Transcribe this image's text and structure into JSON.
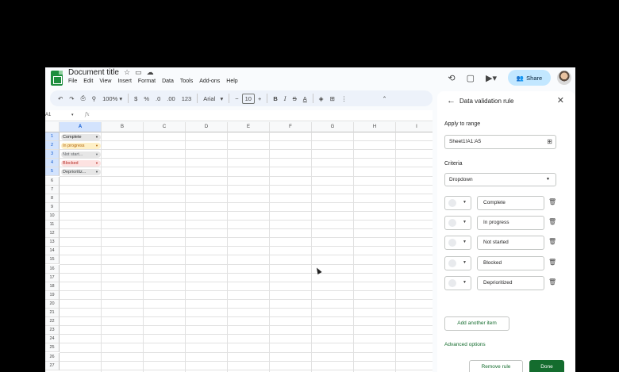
{
  "app": {
    "doc_title": "Document title",
    "menu": [
      "File",
      "Edit",
      "View",
      "Insert",
      "Format",
      "Data",
      "Tools",
      "Add-ons",
      "Help"
    ],
    "share_label": "Share"
  },
  "toolbar": {
    "zoom": "100%",
    "currency": "$",
    "percent": "%",
    "decimal_dec": ".0",
    "decimal_inc": ".00",
    "number_format": "123",
    "font": "Arial",
    "minus": "−",
    "font_size": "10",
    "plus": "+",
    "bold": "B",
    "italic": "I",
    "strike": "S",
    "text_color": "A"
  },
  "formula_bar": {
    "cell_ref": "A1",
    "fx": "fx"
  },
  "grid": {
    "columns": [
      "A",
      "B",
      "C",
      "D",
      "E",
      "F",
      "G",
      "H",
      "I"
    ],
    "rows": [
      "1",
      "2",
      "3",
      "4",
      "5",
      "6",
      "7",
      "8",
      "9",
      "10",
      "11",
      "12",
      "13",
      "14",
      "15",
      "16",
      "17",
      "18",
      "19",
      "20",
      "21",
      "22",
      "23",
      "24",
      "25",
      "26",
      "27"
    ],
    "cells": [
      {
        "text": "Complete",
        "bg": "#e6e6e6",
        "color": "#1f1f1f"
      },
      {
        "text": "In progress",
        "bg": "#fef0c7",
        "color": "#b06000"
      },
      {
        "text": "Not start...",
        "bg": "#e6e6e6",
        "color": "#5f6368"
      },
      {
        "text": "Blocked",
        "bg": "#fde2e1",
        "color": "#b3261e"
      },
      {
        "text": "Deprioritiz...",
        "bg": "#e6e6e6",
        "color": "#3c4043"
      }
    ]
  },
  "panel": {
    "title": "Data validation rule",
    "apply_label": "Apply to range",
    "range_value": "Sheet1!A1:A5",
    "criteria_label": "Criteria",
    "criteria_value": "Dropdown",
    "items": [
      "Complete",
      "In progress",
      "Not started",
      "Blocked",
      "Deprioritized"
    ],
    "add_item_label": "Add another item",
    "advanced_label": "Advanced options",
    "remove_label": "Remove rule",
    "done_label": "Done"
  },
  "colors": {
    "accent": "#146c2e",
    "share_bg": "#c2e7ff",
    "selection": "#d3e3fd"
  }
}
